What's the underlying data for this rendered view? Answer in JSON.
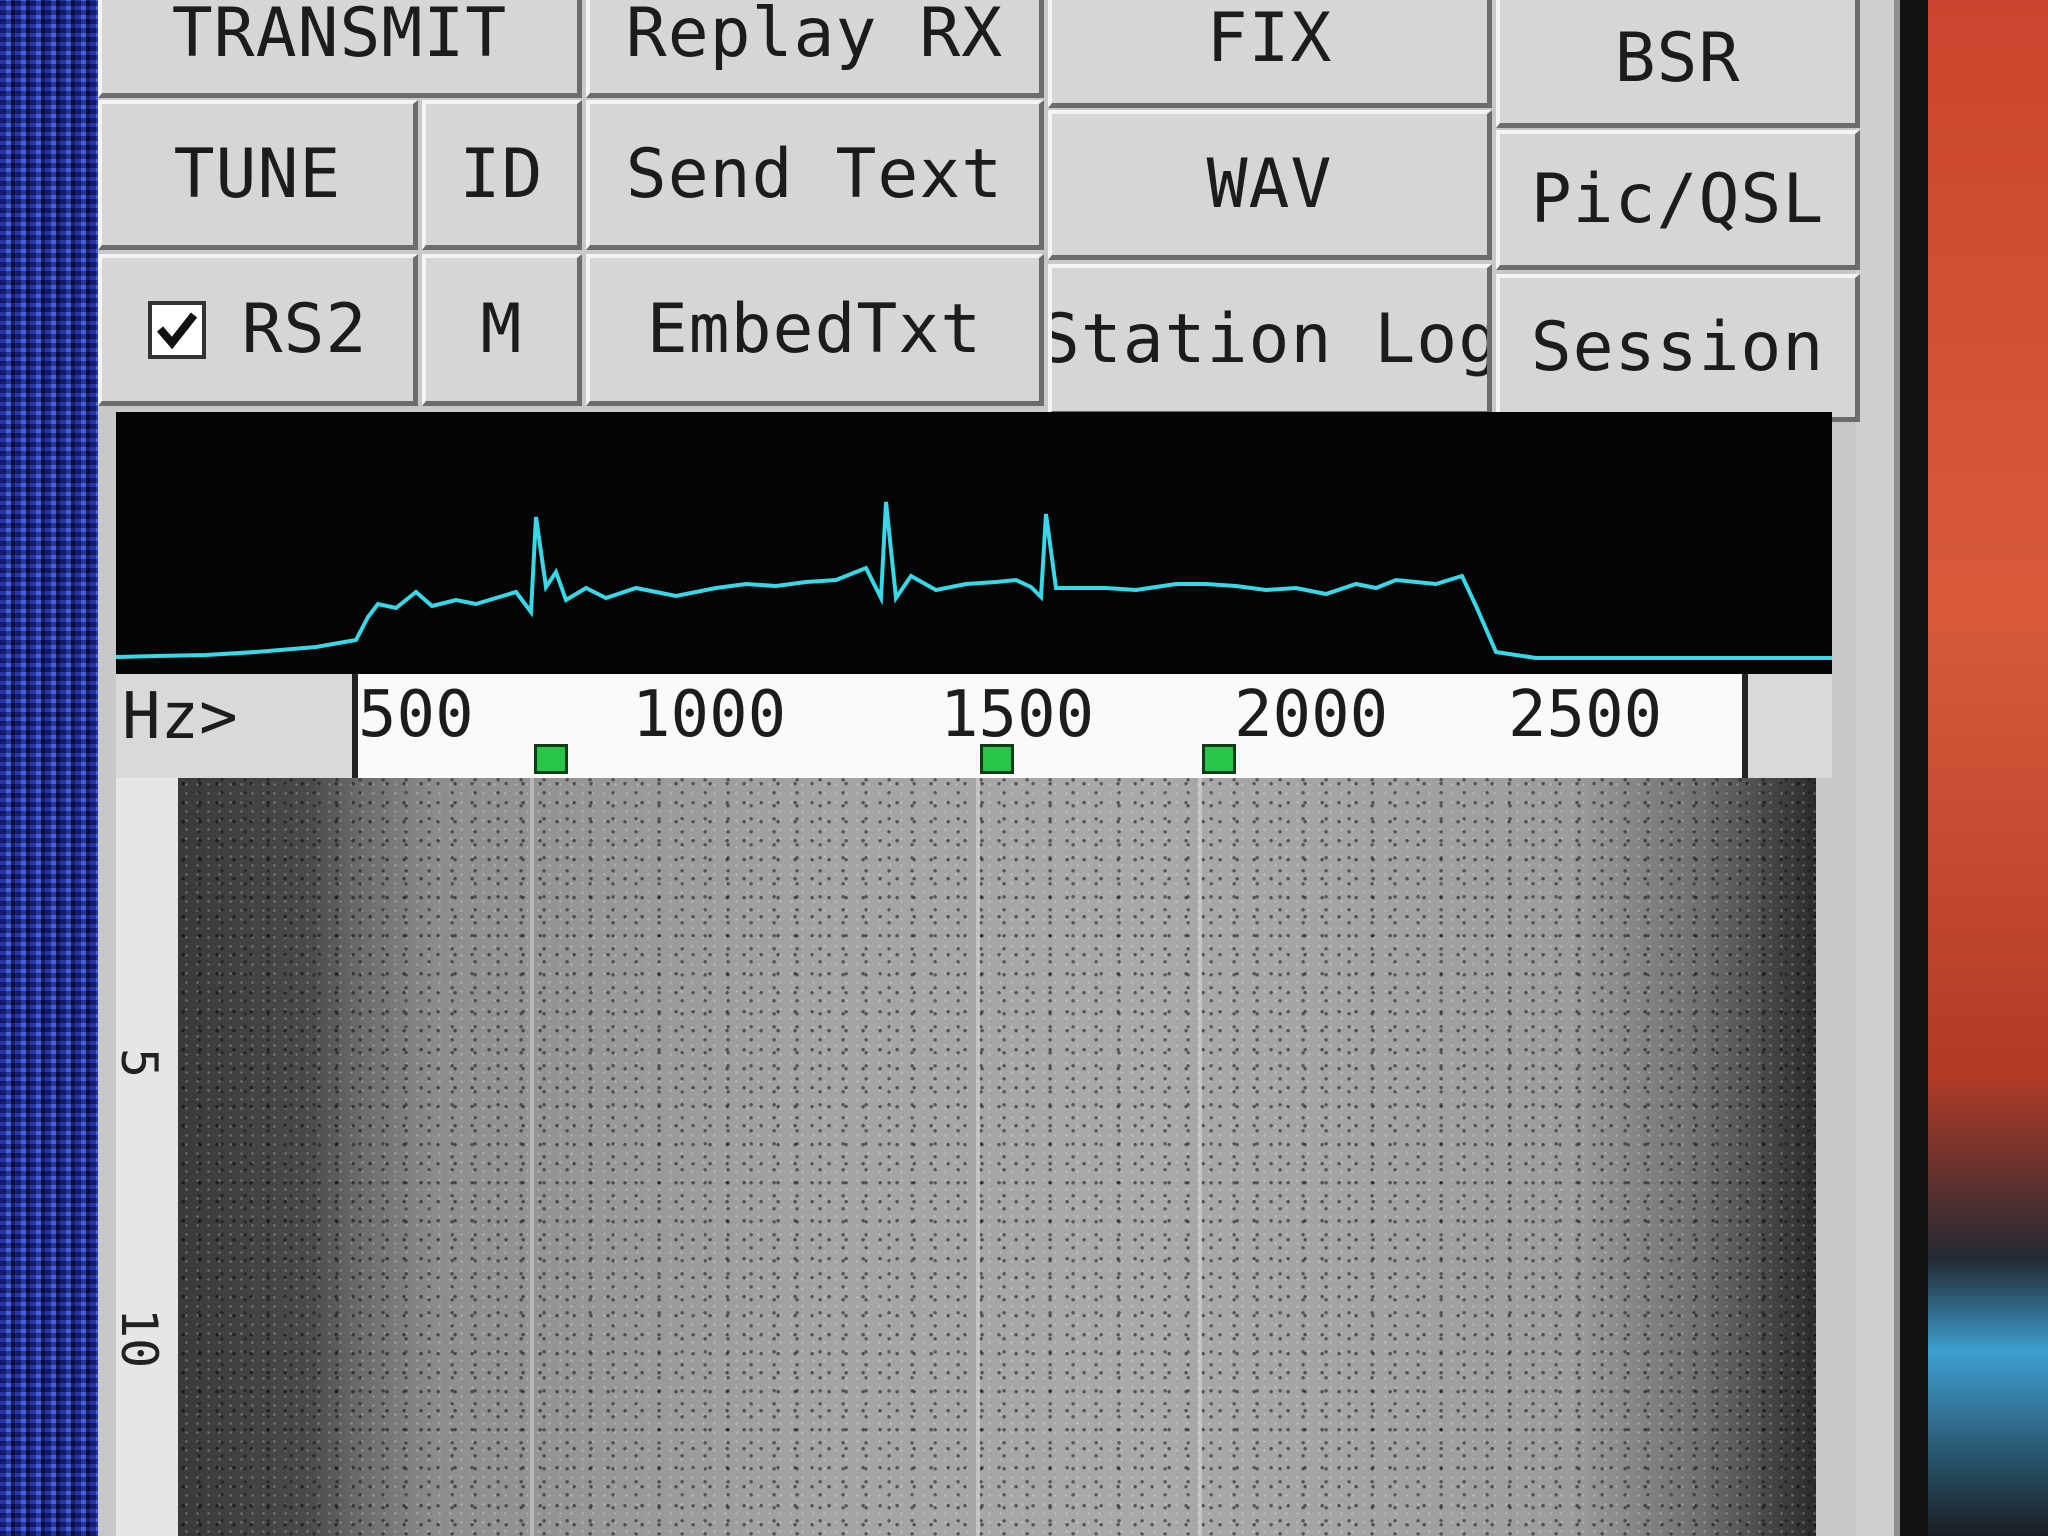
{
  "buttons": {
    "transmit": "TRANSMIT",
    "replay_rx": "Replay RX",
    "fix": "FIX",
    "bsr": "BSR",
    "tune": "TUNE",
    "id": "ID",
    "send_text": "Send Text",
    "wav": "WAV",
    "pic_qsl": "Pic/QSL",
    "rs2": "RS2",
    "m": "M",
    "embed_txt": "EmbedTxt",
    "station_log": "Station Log",
    "session": "Session"
  },
  "rs2_checked": true,
  "frequency_scale": {
    "unit_label": "Hz>",
    "ticks": [
      "500",
      "1000",
      "1500",
      "2000",
      "2500"
    ],
    "markers_hz": [
      800,
      1550,
      1900
    ]
  },
  "time_scale": {
    "labels": [
      "5",
      "10"
    ]
  },
  "colors": {
    "spectrum_trace": "#38d8e8",
    "marker": "#29c44a",
    "window_face": "#d6d6d6"
  }
}
